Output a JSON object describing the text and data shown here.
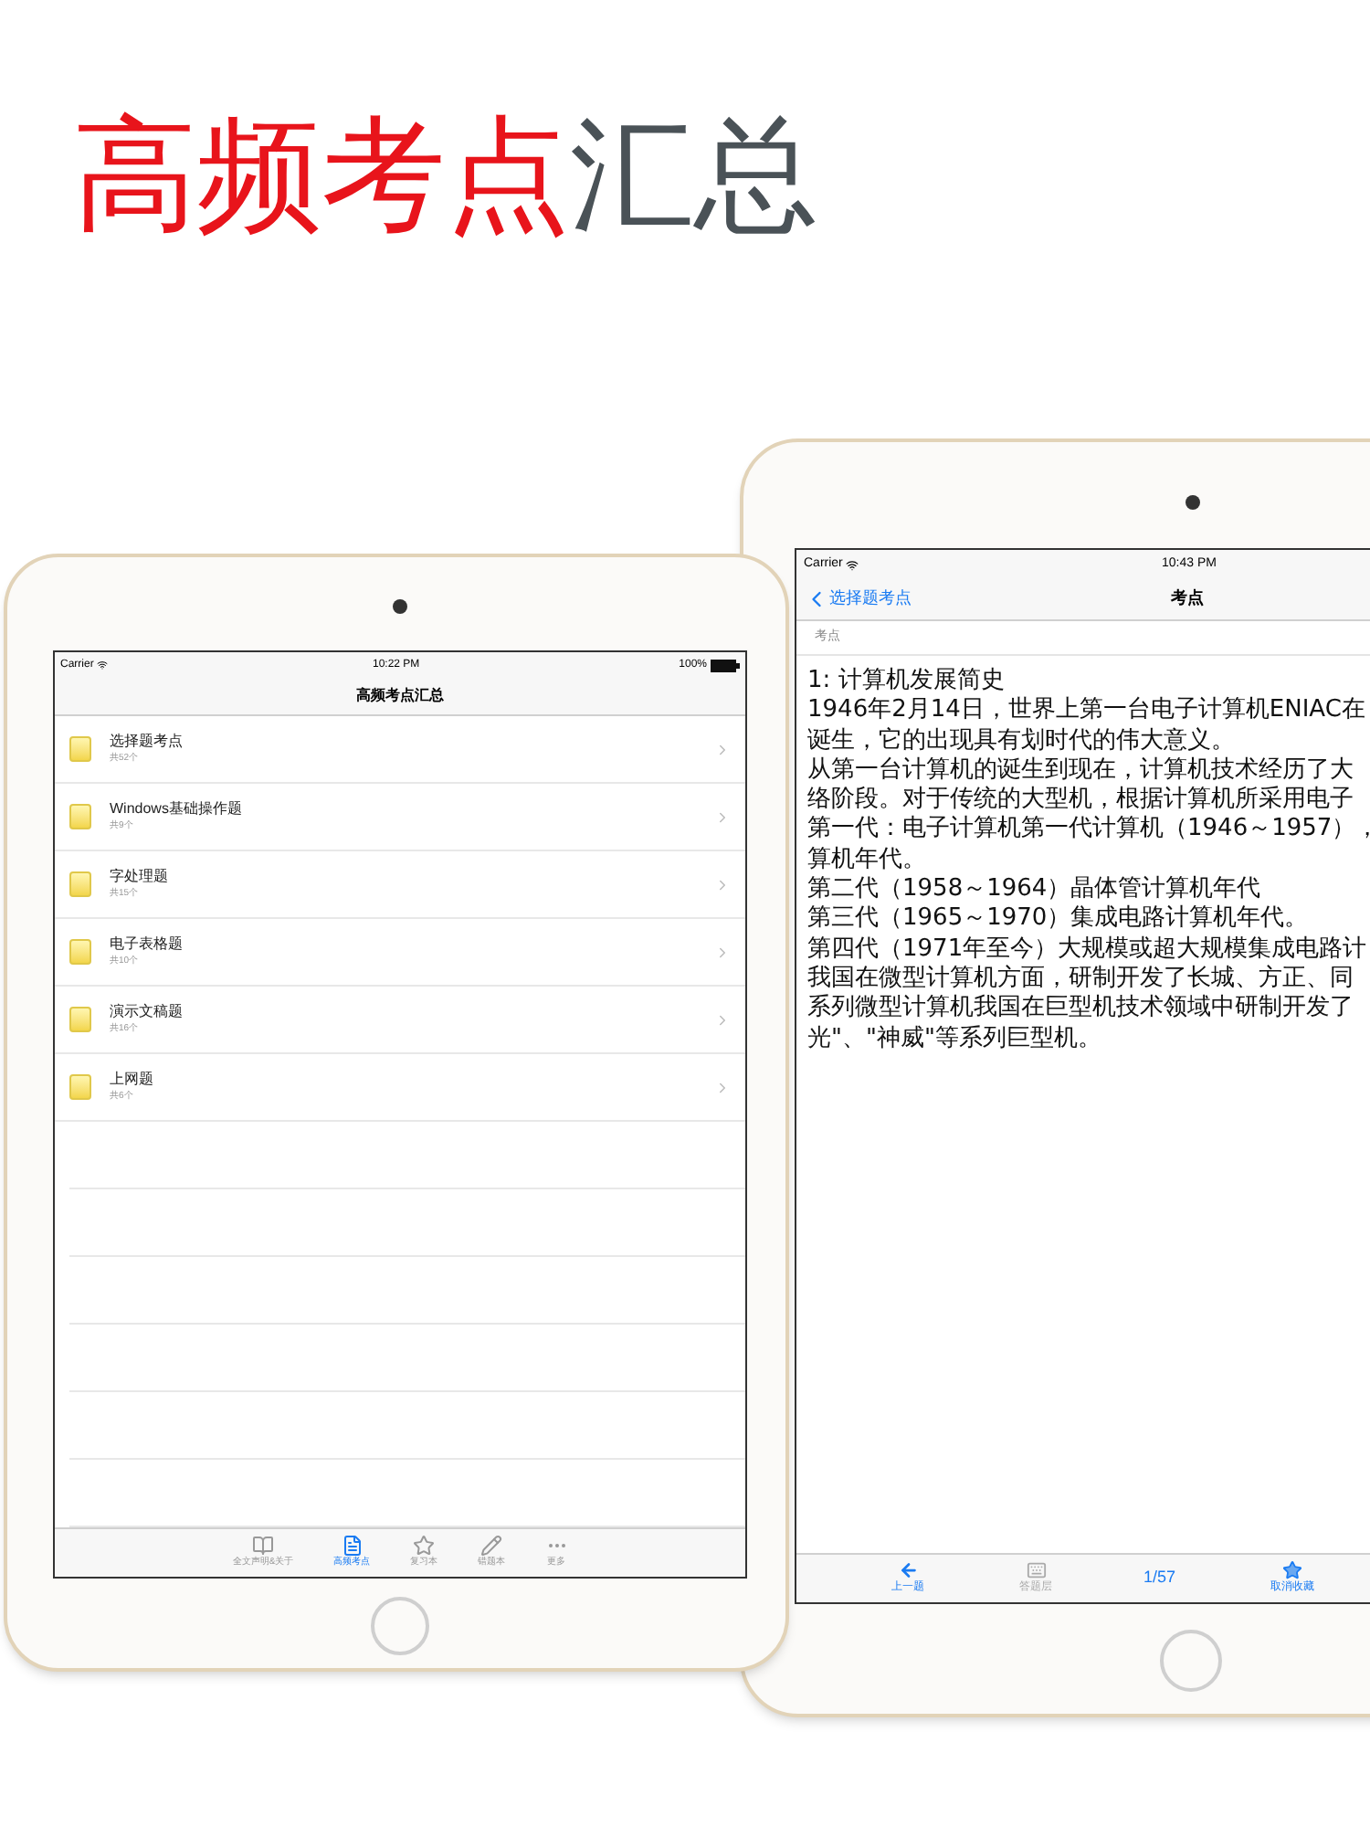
{
  "headline": [
    {
      "text": "高频考点",
      "color": "#e8141b"
    },
    {
      "text": "汇总",
      "color": "#4a5257"
    }
  ],
  "left_ipad": {
    "status_bar": {
      "carrier": "Carrier",
      "time": "10:22 PM",
      "battery": "100%"
    },
    "nav_title": "高频考点汇总",
    "rows": [
      {
        "title": "选择题考点",
        "subtitle": "共52个"
      },
      {
        "title": "Windows基础操作题",
        "subtitle": "共9个"
      },
      {
        "title": "字处理题",
        "subtitle": "共15个"
      },
      {
        "title": "电子表格题",
        "subtitle": "共10个"
      },
      {
        "title": "演示文稿题",
        "subtitle": "共16个"
      },
      {
        "title": "上网题",
        "subtitle": "共6个"
      }
    ],
    "tabs": [
      {
        "label": "全文声明&关于",
        "selected": false
      },
      {
        "label": "高频考点",
        "selected": true
      },
      {
        "label": "复习本",
        "selected": false
      },
      {
        "label": "错题本",
        "selected": false
      },
      {
        "label": "更多",
        "selected": false
      }
    ]
  },
  "right_ipad": {
    "status_bar": {
      "carrier": "Carrier",
      "time": "10:43 PM"
    },
    "back_button": "选择题考点",
    "nav_title": "考点",
    "section_header": "考点",
    "content_lines": [
      "1: 计算机发展简史",
      "1946年2月14日，世界上第一台电子计算机ENIAC在",
      "诞生，它的出现具有划时代的伟大意义。",
      "从第一台计算机的诞生到现在，计算机技术经历了大",
      "络阶段。对于传统的大型机，根据计算机所采用电子",
      "第一代：电子计算机第一代计算机（1946～1957），",
      "算机年代。",
      "第二代（1958～1964）晶体管计算机年代",
      "第三代（1965～1970）集成电路计算机年代。",
      "第四代（1971年至今）大规模或超大规模集成电路计",
      "我国在微型计算机方面，研制开发了长城、方正、同",
      "系列微型计算机我国在巨型机技术领域中研制开发了",
      "光\"、\"神威\"等系列巨型机。"
    ],
    "toolbar": {
      "previous": "上一题",
      "answer_sheet": "答题层",
      "page": "1/57",
      "favorite": "取消收藏"
    }
  }
}
